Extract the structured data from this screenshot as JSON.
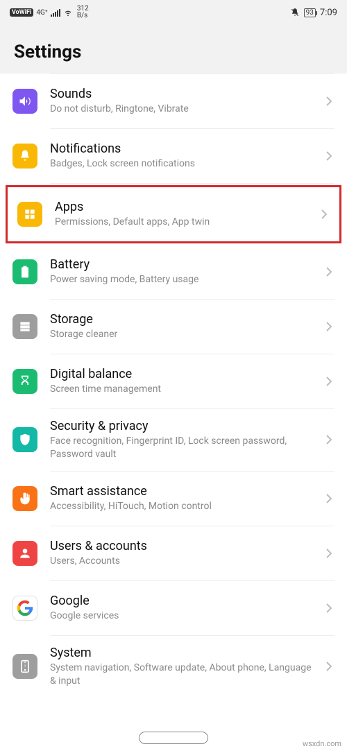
{
  "statusbar": {
    "vowifi": "VoWiFi",
    "network": "4G⁺",
    "speed_value": "312",
    "speed_unit": "B/s",
    "battery": "93",
    "time": "7:09"
  },
  "header": {
    "title": "Settings"
  },
  "items": [
    {
      "title": "Sounds",
      "sub": "Do not disturb, Ringtone, Vibrate",
      "icon": "sound-icon",
      "color": "purple"
    },
    {
      "title": "Notifications",
      "sub": "Badges, Lock screen notifications",
      "icon": "bell-icon",
      "color": "amber"
    },
    {
      "title": "Apps",
      "sub": "Permissions, Default apps, App twin",
      "icon": "apps-icon",
      "color": "amber",
      "highlight": true
    },
    {
      "title": "Battery",
      "sub": "Power saving mode, Battery usage",
      "icon": "battery-icon",
      "color": "green"
    },
    {
      "title": "Storage",
      "sub": "Storage cleaner",
      "icon": "storage-icon",
      "color": "gray"
    },
    {
      "title": "Digital balance",
      "sub": "Screen time management",
      "icon": "hourglass-icon",
      "color": "green"
    },
    {
      "title": "Security & privacy",
      "sub": "Face recognition, Fingerprint ID, Lock screen password, Password vault",
      "icon": "shield-icon",
      "color": "teal"
    },
    {
      "title": "Smart assistance",
      "sub": "Accessibility, HiTouch, Motion control",
      "icon": "hand-icon",
      "color": "orange"
    },
    {
      "title": "Users & accounts",
      "sub": "Users, Accounts",
      "icon": "user-icon",
      "color": "red"
    },
    {
      "title": "Google",
      "sub": "Google services",
      "icon": "google-icon",
      "color": "white"
    },
    {
      "title": "System",
      "sub": "System navigation, Software update, About phone, Language & input",
      "icon": "system-icon",
      "color": "gray"
    }
  ],
  "watermark": "wsxdn.com"
}
